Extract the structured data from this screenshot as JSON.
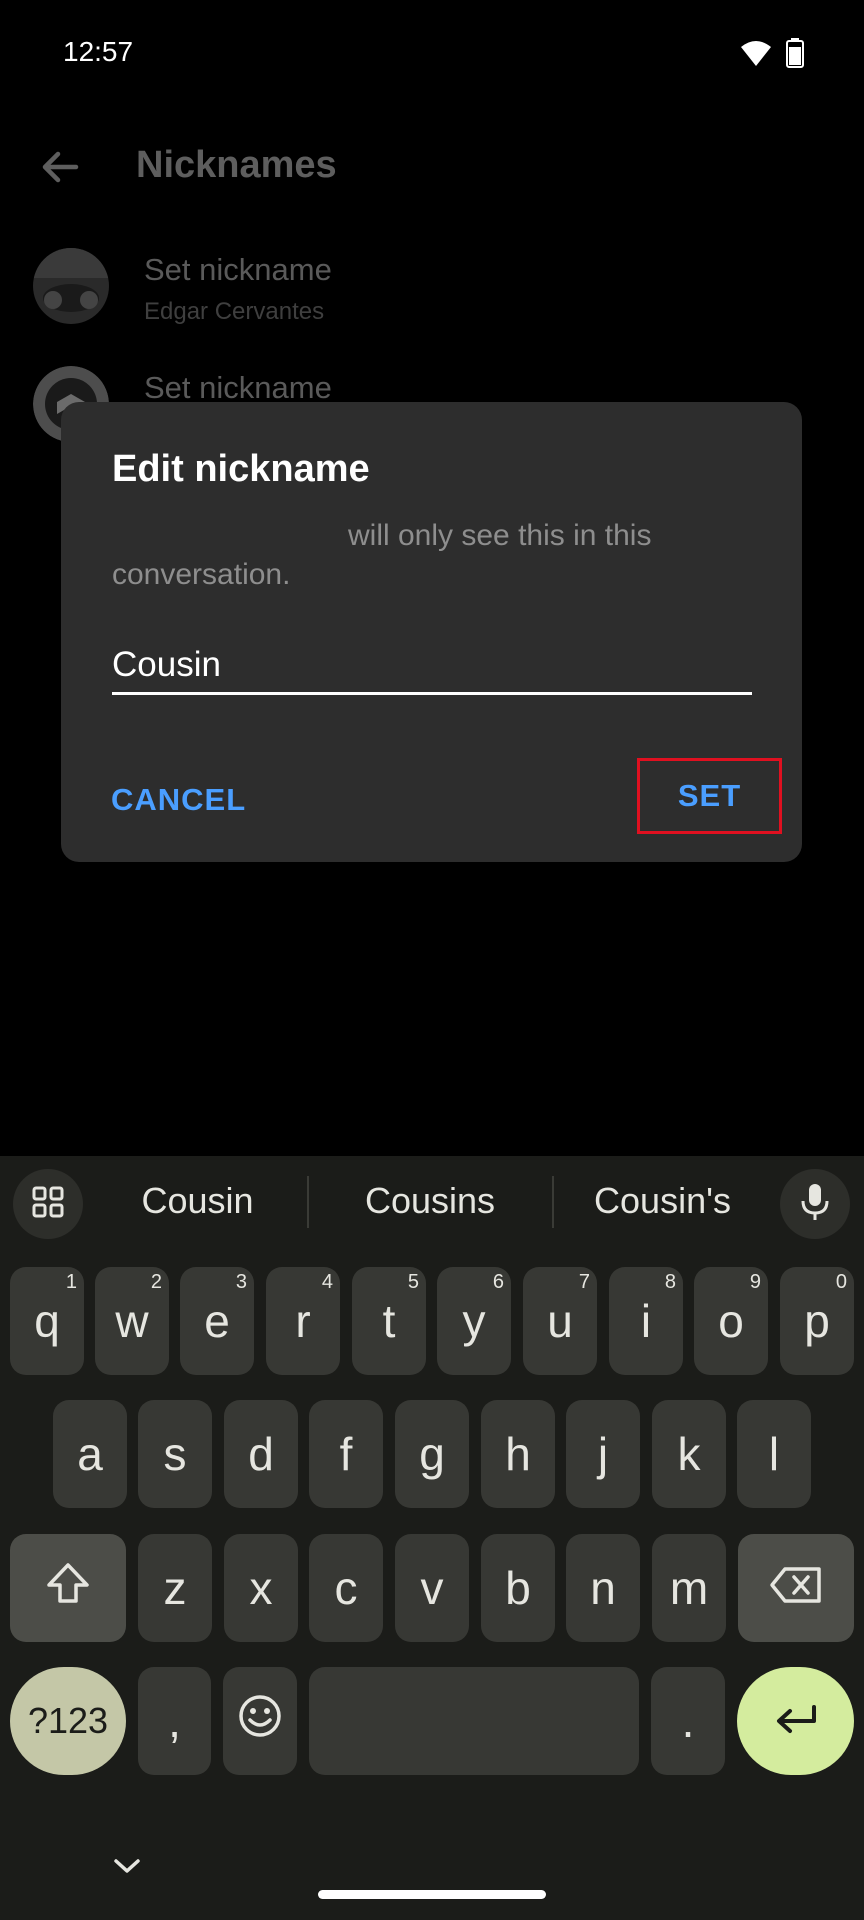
{
  "status": {
    "time": "12:57"
  },
  "app_bar": {
    "title": "Nicknames"
  },
  "nicknames": [
    {
      "title": "Set nickname",
      "subtitle": "Edgar Cervantes"
    },
    {
      "title": "Set nickname",
      "subtitle": ""
    }
  ],
  "dialog": {
    "title": "Edit nickname",
    "message": "will only see this in this conversation.",
    "input_value": "Cousin",
    "cancel_label": "CANCEL",
    "set_label": "SET"
  },
  "keyboard": {
    "suggestions": [
      "Cousin",
      "Cousins",
      "Cousin's"
    ],
    "row1": [
      {
        "k": "q",
        "h": "1"
      },
      {
        "k": "w",
        "h": "2"
      },
      {
        "k": "e",
        "h": "3"
      },
      {
        "k": "r",
        "h": "4"
      },
      {
        "k": "t",
        "h": "5"
      },
      {
        "k": "y",
        "h": "6"
      },
      {
        "k": "u",
        "h": "7"
      },
      {
        "k": "i",
        "h": "8"
      },
      {
        "k": "o",
        "h": "9"
      },
      {
        "k": "p",
        "h": "0"
      }
    ],
    "row2": [
      "a",
      "s",
      "d",
      "f",
      "g",
      "h",
      "j",
      "k",
      "l"
    ],
    "row3": [
      "z",
      "x",
      "c",
      "v",
      "b",
      "n",
      "m"
    ],
    "symbols_label": "?123",
    "comma_label": ",",
    "period_label": "."
  },
  "colors": {
    "accent": "#4a9eff",
    "highlight_border": "#e01020",
    "enter_key": "#d4ec9e"
  }
}
